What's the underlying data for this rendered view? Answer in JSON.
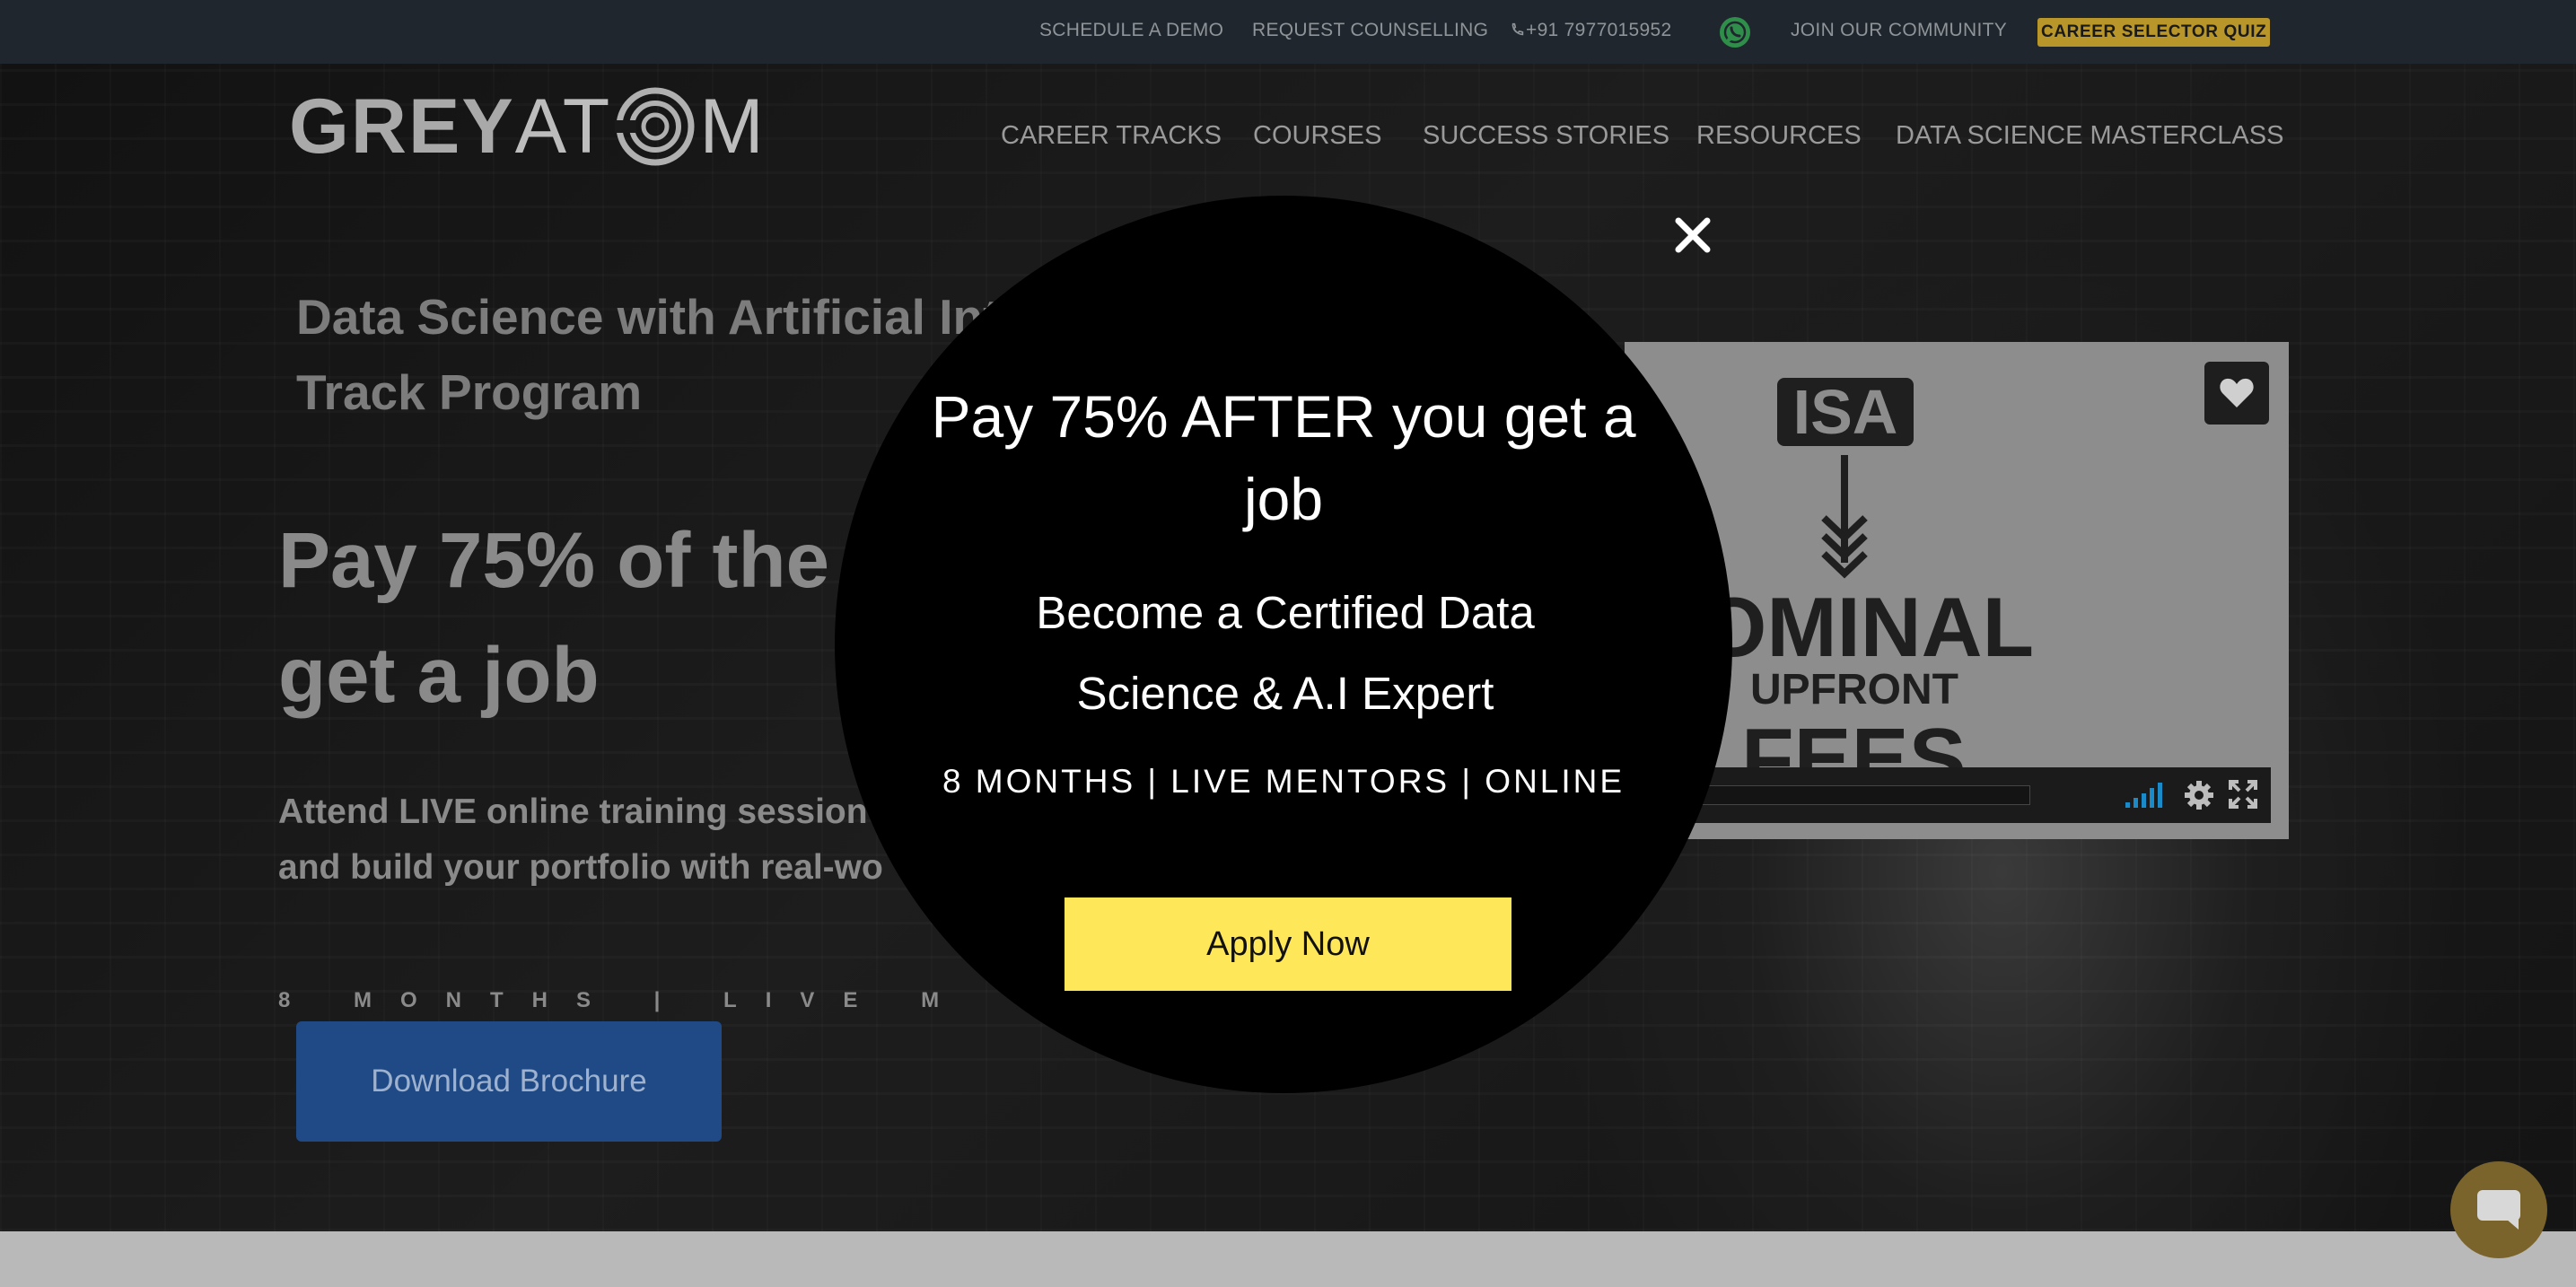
{
  "topbar": {
    "schedule_demo": "SCHEDULE A DEMO",
    "request_counselling": "REQUEST COUNSELLING",
    "phone": "+91 7977015952",
    "join_community": "JOIN OUR COMMUNITY",
    "career_quiz": "CAREER SELECTOR QUIZ"
  },
  "logo": {
    "part1": "GREY",
    "part2": "AT",
    "part3": "M"
  },
  "nav": {
    "items": [
      "CAREER TRACKS",
      "COURSES",
      "SUCCESS STORIES",
      "RESOURCES",
      "DATA SCIENCE MASTERCLASS"
    ]
  },
  "hero": {
    "title_line1": "Data Science with Artificial Int",
    "title_line2": "Track Program",
    "headline_line1": "Pay 75% of the f",
    "headline_line2": "get a job",
    "sub_line1": "Attend LIVE online training session",
    "sub_line2": "and build your portfolio with real-wo",
    "meta": "8 MONTHS | LIVE MENTO",
    "brochure_button": "Download Brochure"
  },
  "video": {
    "isa_label": "ISA",
    "nominal": "OMINAL",
    "upfront": "UPFRONT",
    "fees": "FEES"
  },
  "popup": {
    "title": "Pay 75% AFTER you get a job",
    "subtitle": "Become a Certified Data Science & A.I Expert",
    "meta": "8 MONTHS | LIVE MENTORS | ONLINE",
    "apply_button": "Apply Now"
  },
  "colors": {
    "topbar_bg": "#1f262d",
    "quiz_badge": "#b8962a",
    "brochure_button": "#1f4a85",
    "apply_button": "#ffe75a",
    "whatsapp": "#2f8f4a",
    "chat_button": "#7a642c"
  },
  "icons": [
    "phone-icon",
    "whatsapp-icon",
    "close-icon",
    "heart-icon",
    "volume-icon",
    "settings-icon",
    "fullscreen-icon",
    "chat-icon"
  ]
}
